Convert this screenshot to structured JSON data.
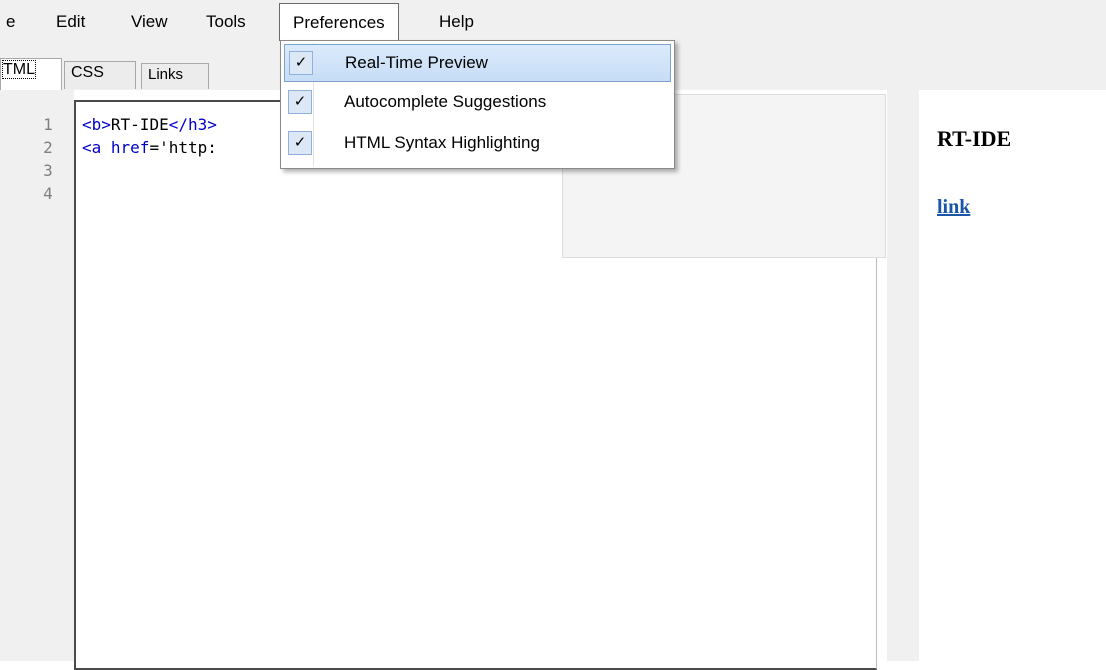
{
  "menubar": {
    "items": [
      "e",
      "Edit",
      "View",
      "Tools",
      "Preferences",
      "Help"
    ]
  },
  "tabs": [
    "TML",
    "CSS",
    "Links"
  ],
  "editor": {
    "line_numbers": [
      "1",
      "2",
      "3",
      "4"
    ],
    "line1": {
      "tag_open": "<b>",
      "text": "RT-IDE",
      "tag_close": "</h3>"
    },
    "line2": {
      "tag": "<a",
      "attr": " href",
      "rest": "='http:"
    }
  },
  "preferences_menu": {
    "items": [
      {
        "label": "Real-Time Preview",
        "checked": true,
        "check": "✓"
      },
      {
        "label": "Autocomplete Suggestions",
        "checked": true,
        "check": "✓"
      },
      {
        "label": "HTML Syntax Highlighting",
        "checked": true,
        "check": "✓"
      }
    ]
  },
  "preview": {
    "heading": "RT-IDE",
    "link": "link"
  },
  "icons": {
    "check": "check-icon"
  }
}
